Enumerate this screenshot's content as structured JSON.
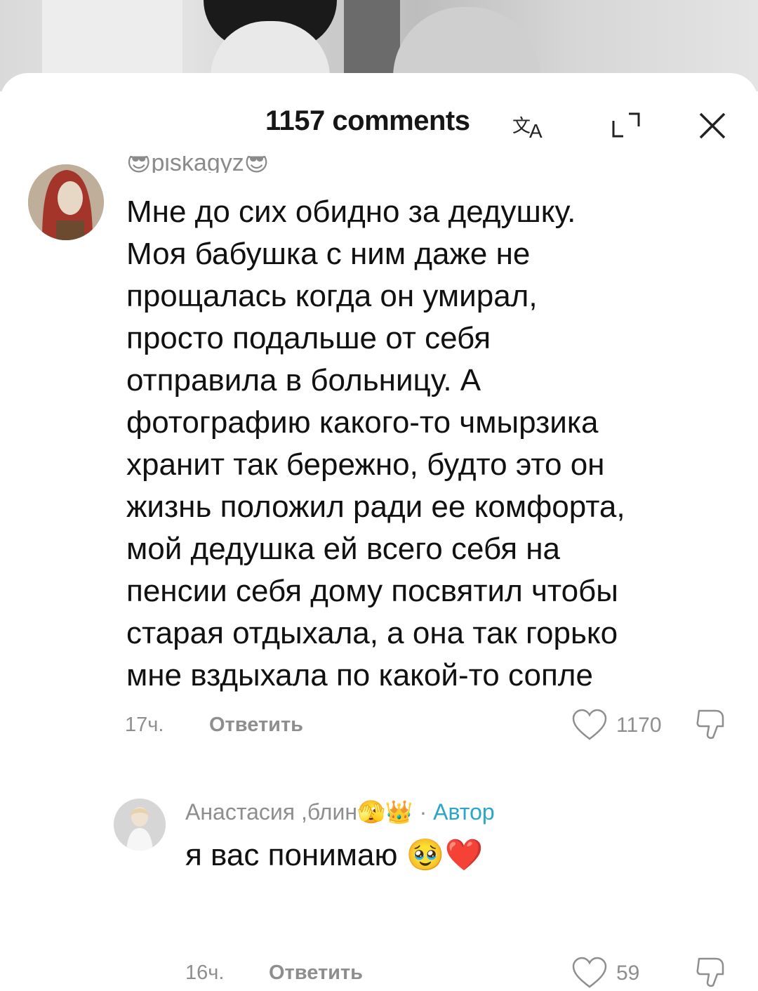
{
  "header": {
    "title": "1157 comments",
    "translate_icon": "translate-icon",
    "expand_icon": "expand-icon",
    "close_icon": "close-icon"
  },
  "comments": [
    {
      "username": "😎piskagyz😎",
      "text": "Мне до сих обидно за дедушку.\nМоя бабушка с ним даже не\nпрощалась когда он умирал,\nпросто подальше от себя\nотправила в больницу. А\nфотографию какого-то чмырзика\nхранит так бережно, будто это он\nжизнь положил ради ее комфорта,\nмой дедушка ей всего себя на\nпенсии себя дому посвятил чтобы\nстарая отдыхала, а она так горько\nмне вздыхала по какой-то сопле",
      "time": "17ч.",
      "reply_label": "Ответить",
      "likes": "1170"
    }
  ],
  "reply": {
    "author": "Анастасия ,блин🫣👑",
    "separator": " · ",
    "badge": "Автор",
    "text": "я вас понимаю 🥹❤️",
    "time": "16ч.",
    "reply_label": "Ответить",
    "likes": "59"
  },
  "colors": {
    "text": "#111111",
    "muted": "#8e8e8e",
    "author_badge": "#2aa6c8"
  }
}
